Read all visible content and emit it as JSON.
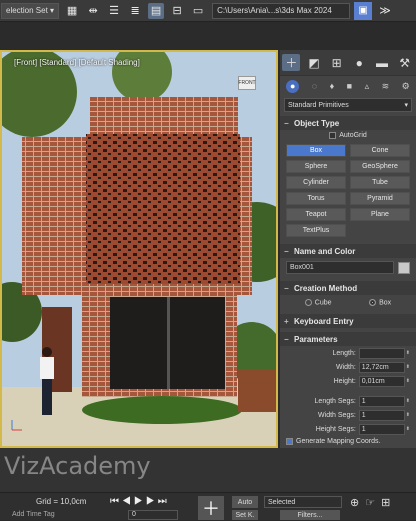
{
  "toolbar": {
    "selection_set": "election Set",
    "path": "C:\\Users\\Ania\\...s\\3ds Max 2024"
  },
  "viewport": {
    "label": "[Front] [Standard] [Default Shading]",
    "navcube_label": "FRONT"
  },
  "panel": {
    "category": "Standard Primitives",
    "object_type": {
      "header": "Object Type",
      "autogrid": "AutoGrid",
      "buttons": [
        "Box",
        "Cone",
        "Sphere",
        "GeoSphere",
        "Cylinder",
        "Tube",
        "Torus",
        "Pyramid",
        "Teapot",
        "Plane",
        "TextPlus"
      ],
      "active": "Box"
    },
    "name_color": {
      "header": "Name and Color",
      "name": "Box001"
    },
    "creation_method": {
      "header": "Creation Method",
      "option_cube": "Cube",
      "option_box": "Box"
    },
    "keyboard_entry": {
      "header": "Keyboard Entry"
    },
    "parameters": {
      "header": "Parameters",
      "length_label": "Length:",
      "length_value": "",
      "width_label": "Width:",
      "width_value": "12,72cm",
      "height_label": "Height:",
      "height_value": "0,01cm",
      "length_segs_label": "Length Segs:",
      "length_segs_value": "1",
      "width_segs_label": "Width Segs:",
      "width_segs_value": "1",
      "height_segs_label": "Height Segs:",
      "height_segs_value": "1",
      "gen_mapping": "Generate Mapping Coords."
    }
  },
  "bottom": {
    "watermark": "VizAcademy",
    "grid": "Grid = 10,0cm",
    "auto": "Auto",
    "setk": "Set K.",
    "selected": "Selected",
    "filters": "Filters...",
    "frame": "0",
    "addtime": "Add Time Tag"
  }
}
